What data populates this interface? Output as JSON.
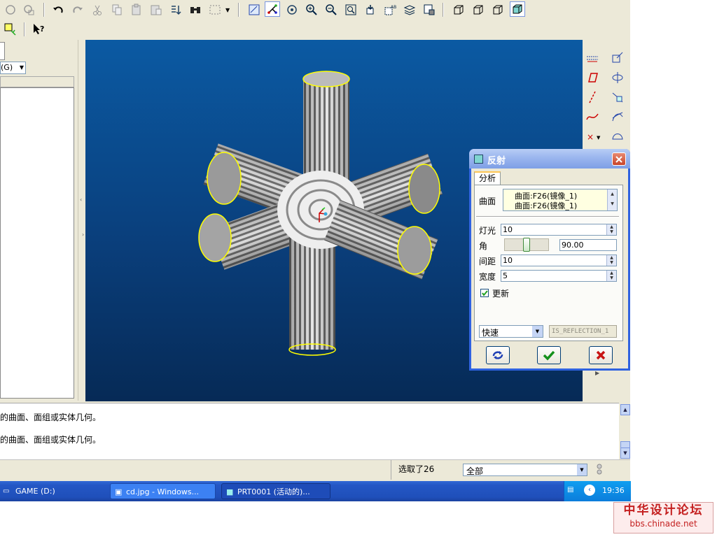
{
  "toolbar_icons": [
    "regenerate-icon",
    "regenerate-manager-icon",
    "undo-icon",
    "redo-icon",
    "cut-icon",
    "copy-icon",
    "paste-icon",
    "paste-special-icon",
    "reorder-icon",
    "find-icon",
    "select-box-icon",
    "repaint-icon",
    "spin-center-icon",
    "orient-icon",
    "zoom-in-icon",
    "zoom-out-icon",
    "refit-icon",
    "reorient-icon",
    "saved-views-icon",
    "layers-icon",
    "view-manager-icon",
    "wireframe-icon",
    "hidden-line-icon",
    "no-hidden-icon",
    "shading-icon"
  ],
  "toolbar2_icons": [
    "filter-icon",
    "whats-this-icon"
  ],
  "navigator": {
    "combo_value": "(G)"
  },
  "messages": [
    "的曲面、面组或实体几何。",
    "的曲面、面组或实体几何。"
  ],
  "status": {
    "selected_text": "选取了26",
    "filter_value": "全部"
  },
  "taskbar": {
    "items": [
      {
        "label": "GAME (D:)"
      },
      {
        "label": "cd.jpg - Windows..."
      },
      {
        "label": "PRT0001 (活动的)..."
      }
    ],
    "clock": "19:36"
  },
  "dialog": {
    "title": "反射",
    "tab": "分析",
    "surface_label": "曲面",
    "surface_items": [
      "曲面:F26(镜像_1)",
      "曲面:F26(镜像_1)"
    ],
    "light_label": "灯光",
    "light_value": "10",
    "angle_label": "角",
    "angle_value": "90.00",
    "angle_fraction": 0.5,
    "spacing_label": "间距",
    "spacing_value": "10",
    "width_label": "宽度",
    "width_value": "5",
    "update_label": "更新",
    "update_checked": true,
    "mode_value": "快速",
    "result_name": "IS_REFLECTION_1"
  },
  "watermark": {
    "line1": "中华设计论坛",
    "line2": "bbs.chinade.net"
  },
  "colors": {
    "accent": "#2f62e0",
    "viewport_top": "#0b5aa3",
    "viewport_bottom": "#062a56",
    "edge_highlight": "#ffff00"
  }
}
